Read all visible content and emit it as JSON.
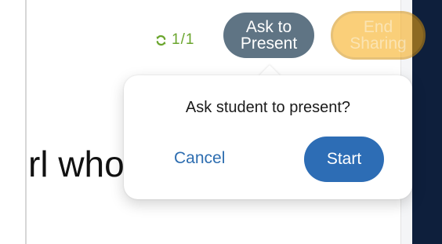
{
  "toolbar": {
    "sync_count": "1/1",
    "ask_to_present_line1": "Ask to",
    "ask_to_present_line2": "Present",
    "end_sharing_line1": "End",
    "end_sharing_line2": "Sharing"
  },
  "slide": {
    "visible_text": "rl who"
  },
  "dialog": {
    "prompt": "Ask student to present?",
    "cancel_label": "Cancel",
    "start_label": "Start"
  },
  "colors": {
    "sync_green": "#6aa52d",
    "ask_button": "#5f7484",
    "end_button": "#f7a80d",
    "primary_blue": "#2d6db5",
    "link_blue": "#2d6db0",
    "side_panel": "#0e1f3c"
  },
  "icons": {
    "sync": "sync-icon"
  }
}
